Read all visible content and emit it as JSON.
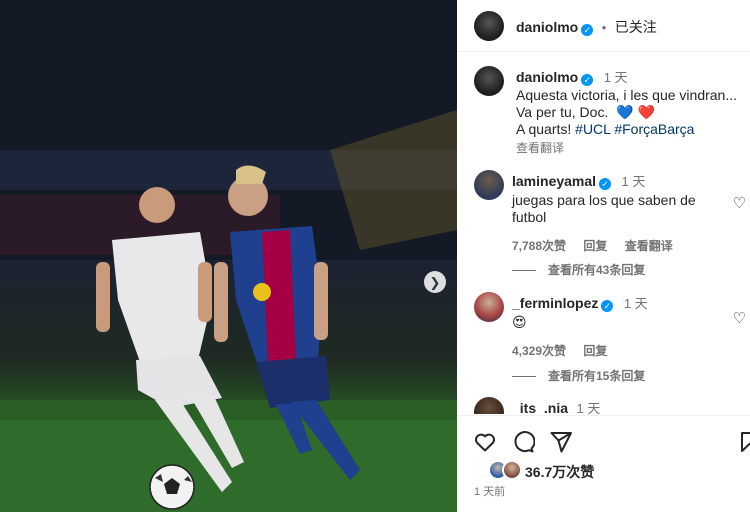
{
  "post": {
    "author": "daniolmo",
    "follow_status": "已关注",
    "separator": "•",
    "caption_author": "daniolmo",
    "caption_time": "1 天",
    "caption_line1": "Aquesta victoria, i les que vindran...",
    "caption_line2": "Va per tu, Doc.",
    "caption_emoji": "💙 ❤️",
    "caption_line3_prefix": "A quarts!",
    "hashtag1": "#UCL",
    "hashtag2": "#ForçaBarça",
    "translate": "查看翻译",
    "likes": "36.7万次赞",
    "posted": "1 天前"
  },
  "comments": [
    {
      "user": "lamineyamal",
      "time": "1 天",
      "text_line1": "juegas para los que saben de",
      "text_line2": "futbol",
      "likes": "7,788次赞",
      "reply": "回复",
      "translate": "查看翻译",
      "view_replies": "查看所有43条回复"
    },
    {
      "user": "_ferminlopez",
      "time": "1 天",
      "text": "😍",
      "likes": "4,329次赞",
      "reply": "回复",
      "view_replies": "查看所有15条回复"
    },
    {
      "user": "_its_.nia",
      "time": "1 天"
    }
  ],
  "icons": {
    "verified": "verified-badge-icon",
    "heart": "heart-outline-icon",
    "comment": "comment-bubble-icon",
    "share": "paper-plane-icon",
    "save": "bookmark-icon",
    "next": "chevron-right-icon"
  },
  "colors": {
    "verified": "#0095f6",
    "hashtag": "#00376b",
    "muted": "#737373",
    "barca_blue": "#1f3f8f",
    "barca_red": "#a50044"
  }
}
